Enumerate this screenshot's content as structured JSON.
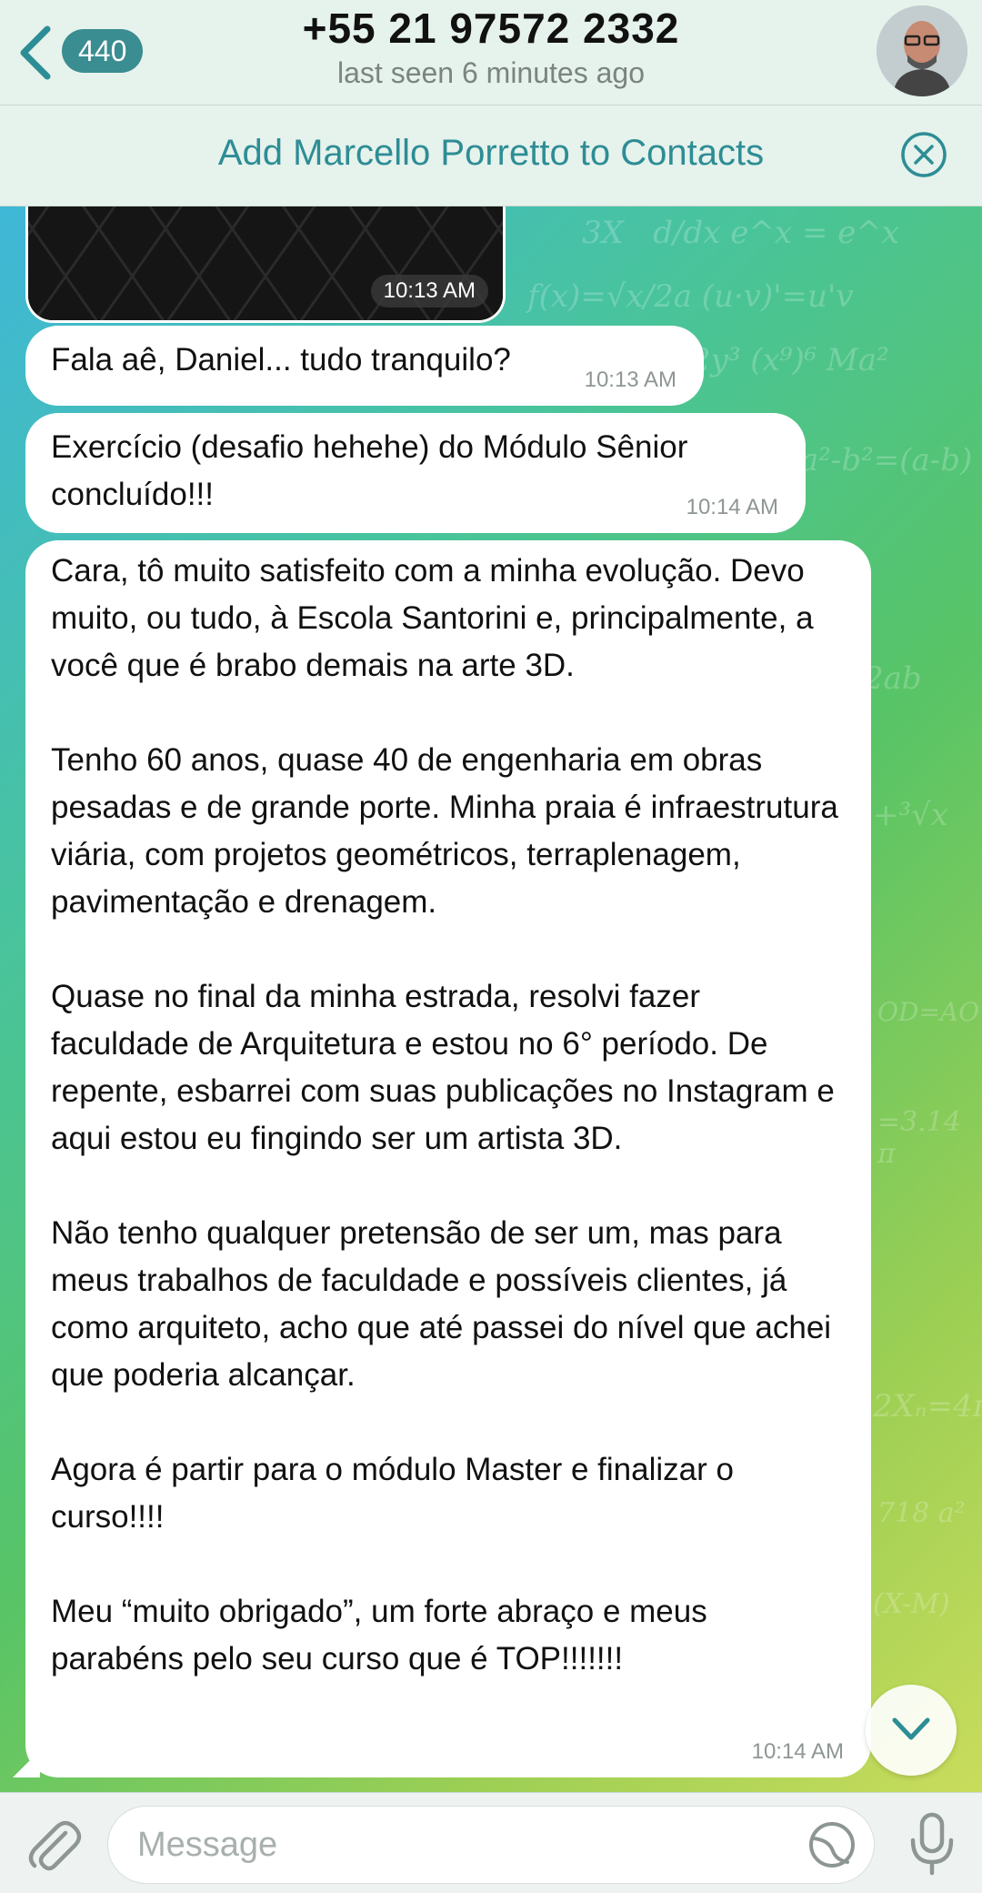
{
  "header": {
    "back_count": "440",
    "title": "+55 21 97572 2332",
    "status": "last seen 6 minutes ago"
  },
  "add_contact": {
    "label": "Add Marcello Porretto to Contacts"
  },
  "messages": [
    {
      "type": "media",
      "time": "10:13 AM"
    },
    {
      "type": "text",
      "text": "Fala aê, Daniel... tudo tranquilo?",
      "time": "10:13 AM"
    },
    {
      "type": "text",
      "text": "Exercício (desafio hehehe) do Módulo Sênior concluído!!!",
      "time": "10:14 AM"
    },
    {
      "type": "text",
      "paragraphs": [
        "Cara, tô muito satisfeito com a minha evolução. Devo muito, ou tudo, à Escola Santorini e, principalmente, a você que é brabo demais na arte 3D.",
        "Tenho 60 anos, quase 40 de engenharia em obras pesadas e de grande porte. Minha praia é infraestrutura viária, com projetos geométricos, terraplenagem, pavimentação e drenagem.",
        "Quase no final da minha estrada, resolvi fazer faculdade de Arquitetura e estou no 6° período. De repente, esbarrei com suas publicações no Instagram e aqui estou eu fingindo ser um artista 3D.",
        "Não tenho qualquer pretensão de ser um, mas para meus trabalhos de faculdade e possíveis clientes, já como arquiteto, acho que até passei do nível que achei que poderia alcançar.",
        "Agora é partir para o módulo Master e finalizar o curso!!!!",
        "Meu “muito obrigado”, um forte abraço e meus parabéns pelo seu curso que é TOP!!!!!!!"
      ],
      "time": "10:14 AM"
    }
  ],
  "composer": {
    "placeholder": "Message"
  },
  "icons": {
    "back": "chevron-left-icon",
    "close": "close-circle-icon",
    "scroll": "chevron-down-icon",
    "attach": "paperclip-icon",
    "sticker": "sticker-icon",
    "mic": "microphone-icon"
  },
  "colors": {
    "accent": "#2d8d95",
    "badge": "#3a8d91",
    "bubble": "#ffffff"
  }
}
